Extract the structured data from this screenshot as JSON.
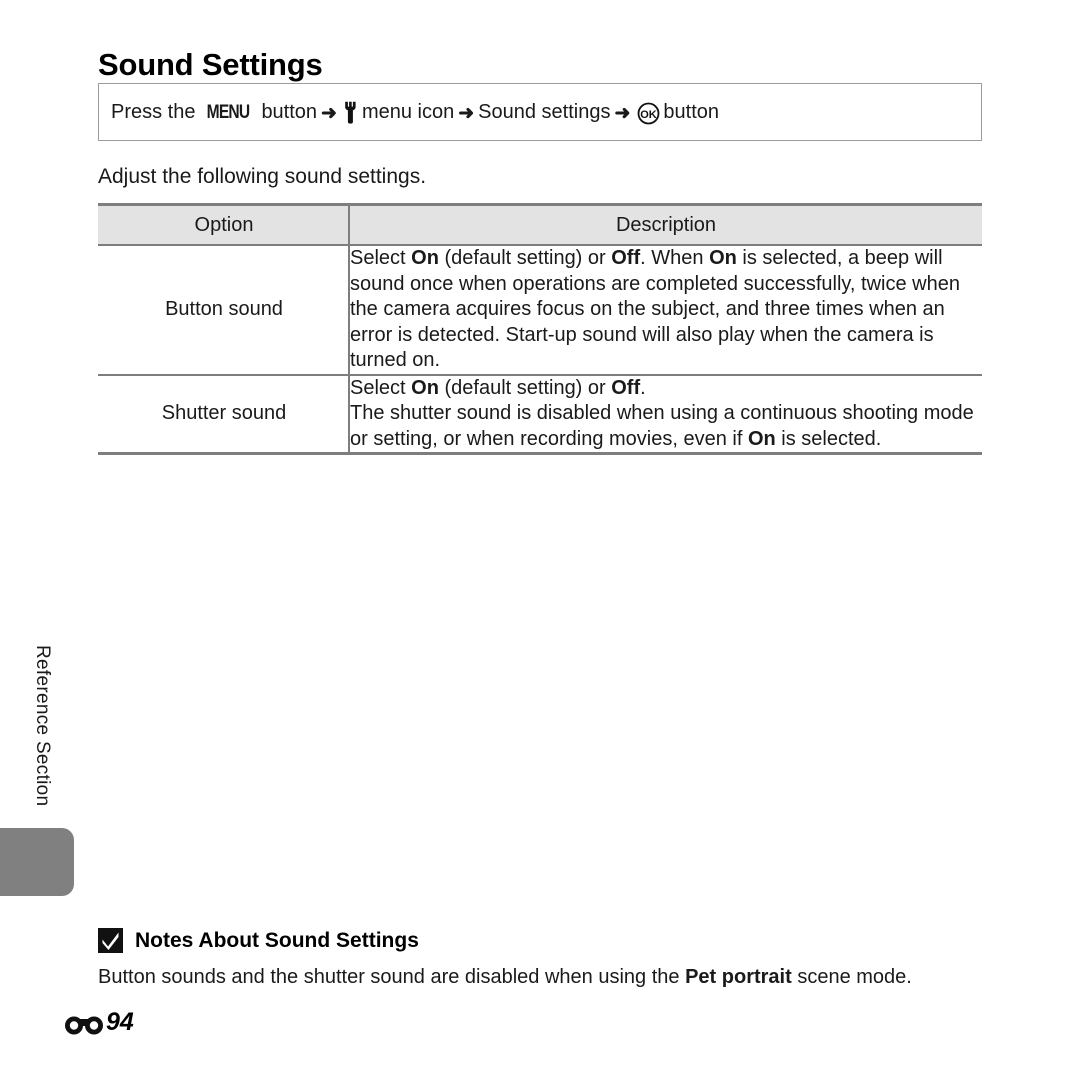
{
  "document": {
    "title": "Sound Settings"
  },
  "instruction": {
    "part1": "Press the",
    "menu_label": "MENU",
    "part2": "button",
    "arrow": "➜",
    "setup_icon": "wrench-icon",
    "part3": "menu icon",
    "part4": "Sound settings",
    "ok_icon": "ok-button-icon",
    "part5": "button"
  },
  "lead_text": "Adjust the following sound settings.",
  "table": {
    "headers": {
      "option": "Option",
      "description": "Description"
    },
    "rows": [
      {
        "option": "Button sound",
        "description_html": "Select <b>On</b> (default setting) or <b>Off</b>. When <b>On</b> is selected, a beep will sound once when operations are completed successfully, twice when the camera acquires focus on the subject, and three times when an error is detected. Start-up sound will also play when the camera is turned on."
      },
      {
        "option": "Shutter sound",
        "description_html": "Select <b>On</b> (default setting) or <b>Off</b>.<br>The shutter sound is disabled when using a continuous shooting mode or setting, or when recording movies, even if <b>On</b> is selected."
      }
    ]
  },
  "side_tab": {
    "label": "Reference Section",
    "tab_color": "#808080"
  },
  "notes": {
    "icon": "check-mark-icon",
    "title": "Notes About Sound Settings",
    "body_html": "Button sounds and the shutter sound are disabled when using the <b>Pet portrait</b> scene mode."
  },
  "footer": {
    "section_glyph": "reference-section-icon",
    "page_number": "94"
  },
  "colors": {
    "table_border": "#7e7e7e",
    "table_header_bg": "#e3e3e3",
    "box_border": "#9c9c9c",
    "tab_gray": "#808080"
  }
}
